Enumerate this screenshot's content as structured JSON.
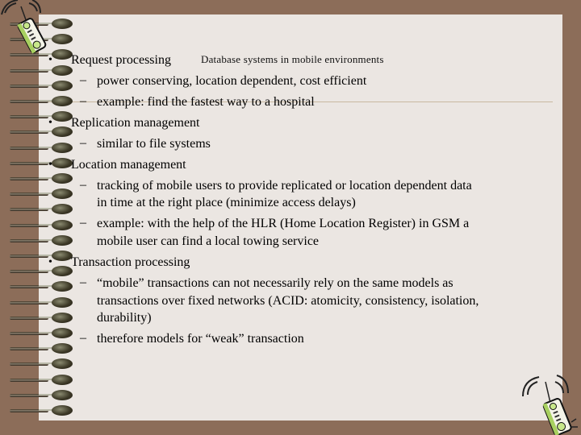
{
  "slide": {
    "subtitle": "Database systems in mobile environments",
    "items": [
      {
        "bullet": "•",
        "text": "Request processing",
        "subitems": [
          {
            "dash": "–",
            "lines": [
              "power conserving, location dependent, cost efficient"
            ]
          },
          {
            "dash": "–",
            "lines": [
              "example: find the fastest way to a hospital"
            ]
          }
        ]
      },
      {
        "bullet": "•",
        "text": "Replication management",
        "subitems": [
          {
            "dash": "–",
            "lines": [
              "similar to file systems"
            ]
          }
        ]
      },
      {
        "bullet": "•",
        "text": "Location management",
        "subitems": [
          {
            "dash": "–",
            "lines": [
              "tracking of mobile users to provide replicated or location dependent data",
              "in time at the right place (minimize access delays)"
            ]
          },
          {
            "dash": "–",
            "lines": [
              "example: with the help of the HLR (Home Location Register) in GSM a",
              "mobile user can find a local towing service"
            ]
          }
        ]
      },
      {
        "bullet": "•",
        "text": "Transaction processing",
        "subitems": [
          {
            "dash": "–",
            "lines": [
              "“mobile” transactions can not necessarily rely on the same models as",
              "transactions over fixed networks (ACID: atomicity, consistency, isolation,",
              "durability)"
            ]
          },
          {
            "dash": "–",
            "lines": [
              "therefore models for “weak” transaction"
            ]
          }
        ]
      }
    ]
  },
  "icons": {
    "top_left": "mobile-phone-icon",
    "bottom_right": "mobile-phone-icon"
  },
  "colors": {
    "background": "#8c6d59",
    "paper": "#ebe6e2",
    "text": "#000000",
    "rule": "#c8b8a0",
    "phone_green": "#c8e88a"
  }
}
